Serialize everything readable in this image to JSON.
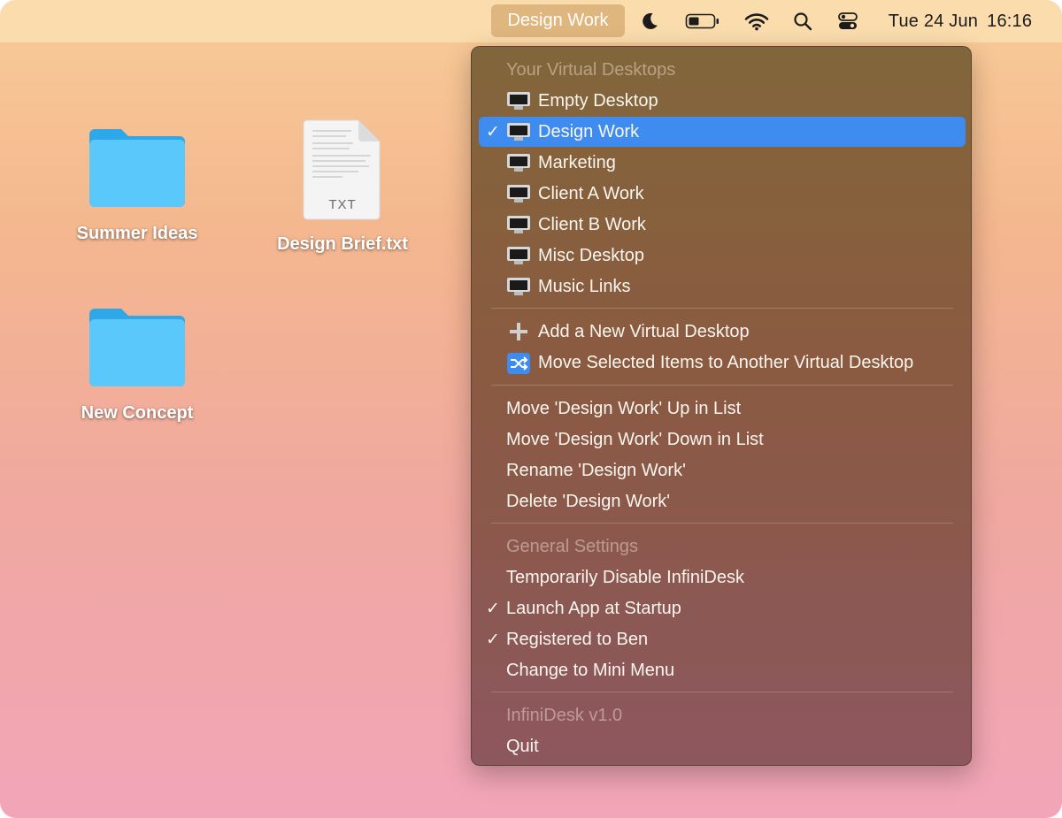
{
  "menubar": {
    "app_name": "Design Work",
    "date": "Tue 24 Jun",
    "time": "16:16",
    "status_icons": [
      "moon-icon",
      "battery-icon",
      "wifi-icon",
      "search-icon",
      "control-center-icon"
    ]
  },
  "desktop": {
    "icons": [
      {
        "label": "Summer Ideas",
        "type": "folder"
      },
      {
        "label": "Design Brief.txt",
        "type": "text-file",
        "badge": "TXT"
      },
      {
        "label": "New Concept",
        "type": "folder"
      }
    ]
  },
  "menu": {
    "section_desktops": "Your Virtual Desktops",
    "desktops": [
      {
        "label": "Empty Desktop",
        "checked": false
      },
      {
        "label": "Design Work",
        "checked": true,
        "selected": true
      },
      {
        "label": "Marketing",
        "checked": false
      },
      {
        "label": "Client A Work",
        "checked": false
      },
      {
        "label": "Client B Work",
        "checked": false
      },
      {
        "label": "Misc Desktop",
        "checked": false
      },
      {
        "label": "Music Links",
        "checked": false
      }
    ],
    "add_desktop": "Add a New Virtual Desktop",
    "move_items": "Move Selected Items to Another Virtual Desktop",
    "move_up": "Move 'Design Work' Up in List",
    "move_down": "Move 'Design Work' Down in List",
    "rename": "Rename 'Design Work'",
    "delete": "Delete 'Design Work'",
    "section_settings": "General Settings",
    "disable": "Temporarily Disable InfiniDesk",
    "launch_startup": "Launch App at Startup",
    "registered": "Registered to Ben",
    "mini_menu": "Change to Mini Menu",
    "version": "InfiniDesk v1.0",
    "quit": "Quit",
    "check_mark": "✓",
    "colors": {
      "selection": "#3f8cf0",
      "folder": "#5ac8fa"
    }
  }
}
